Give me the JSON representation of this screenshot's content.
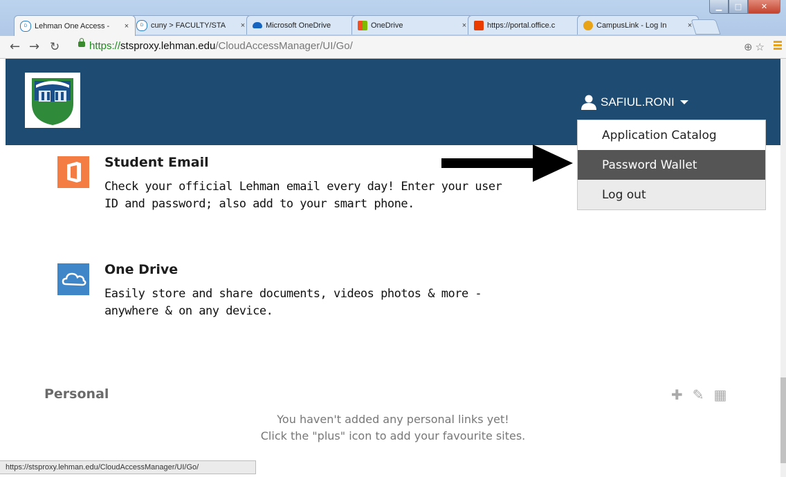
{
  "browser": {
    "tabs": [
      {
        "title": "Lehman One Access -",
        "active": true
      },
      {
        "title": "cuny > FACULTY/STA",
        "active": false
      },
      {
        "title": "Microsoft OneDrive",
        "active": false
      },
      {
        "title": "OneDrive",
        "active": false
      },
      {
        "title": "https://portal.office.c",
        "active": false
      },
      {
        "title": "CampusLink - Log In",
        "active": false
      }
    ],
    "tab_close": "×",
    "url_scheme": "https://",
    "url_host": "stsproxy.lehman.edu",
    "url_path": "/CloudAccessManager/UI/Go/",
    "status_url": "https://stsproxy.lehman.edu/CloudAccessManager/UI/Go/"
  },
  "header": {
    "username": "SAFIUL.RONI",
    "bg_color": "#1e4b72"
  },
  "user_menu": {
    "items": [
      {
        "label": "Application Catalog",
        "state": "normal"
      },
      {
        "label": "Password Wallet",
        "state": "hover"
      },
      {
        "label": "Log out",
        "state": "normal"
      }
    ]
  },
  "apps": [
    {
      "name": "Student Email",
      "description": "Check your official Lehman email every day! Enter your user ID and password; also add to your smart phone.",
      "icon": "office-icon",
      "color": "#f37d43"
    },
    {
      "name": "One Drive",
      "description": "Easily store and share documents, videos photos & more - anywhere & on any device.",
      "icon": "cloud-icon",
      "color": "#3f86c8"
    }
  ],
  "personal": {
    "title": "Personal",
    "empty_line1": "You haven't added any personal links yet!",
    "empty_line2": "Click the \"plus\" icon to add your favourite sites."
  }
}
